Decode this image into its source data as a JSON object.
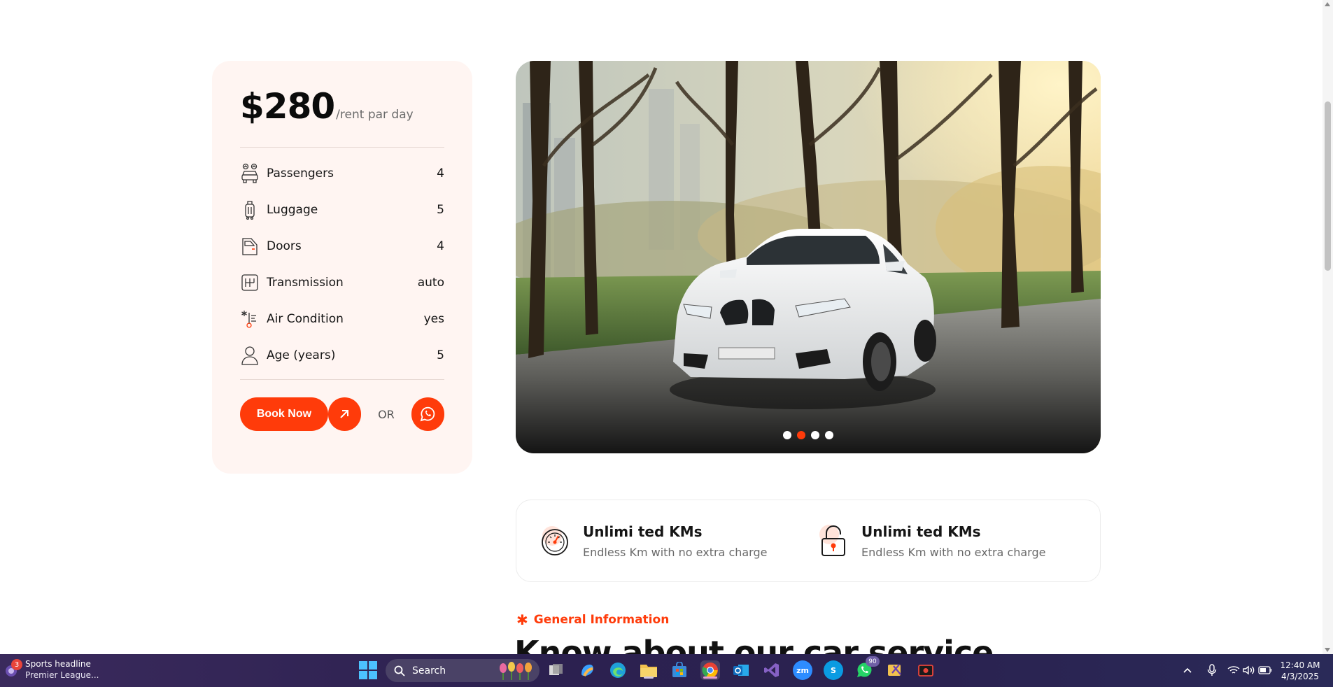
{
  "price": {
    "amount": "$280",
    "unit": "/rent par day"
  },
  "specs": [
    {
      "label": "Passengers",
      "value": "4",
      "icon": "passengers-icon"
    },
    {
      "label": "Luggage",
      "value": "5",
      "icon": "luggage-icon"
    },
    {
      "label": "Doors",
      "value": "4",
      "icon": "door-icon"
    },
    {
      "label": "Transmission",
      "value": "auto",
      "icon": "gearbox-icon"
    },
    {
      "label": "Air Condition",
      "value": "yes",
      "icon": "air-condition-icon"
    },
    {
      "label": "Age (years)",
      "value": "5",
      "icon": "person-icon"
    }
  ],
  "actions": {
    "book_label": "Book Now",
    "or_label": "OR"
  },
  "carousel": {
    "dot_count": 4,
    "active_index": 1
  },
  "features": [
    {
      "title": "Unlimi ted KMs",
      "desc": "Endless Km with no extra charge",
      "icon": "speedometer-icon"
    },
    {
      "title": "Unlimi ted KMs",
      "desc": "Endless Km with no extra charge",
      "icon": "unlock-icon"
    }
  ],
  "general_info": {
    "label": "General Information",
    "heading": "Know about our car service"
  },
  "colors": {
    "accent": "#ff3b0a",
    "card_bg": "#fff5f2"
  },
  "taskbar": {
    "news_badge": "3",
    "news_title": "Sports headline",
    "news_sub": "Premier League...",
    "search_placeholder": "Search",
    "whatsapp_badge": "90",
    "time": "12:40 AM",
    "date": "4/3/2025"
  }
}
